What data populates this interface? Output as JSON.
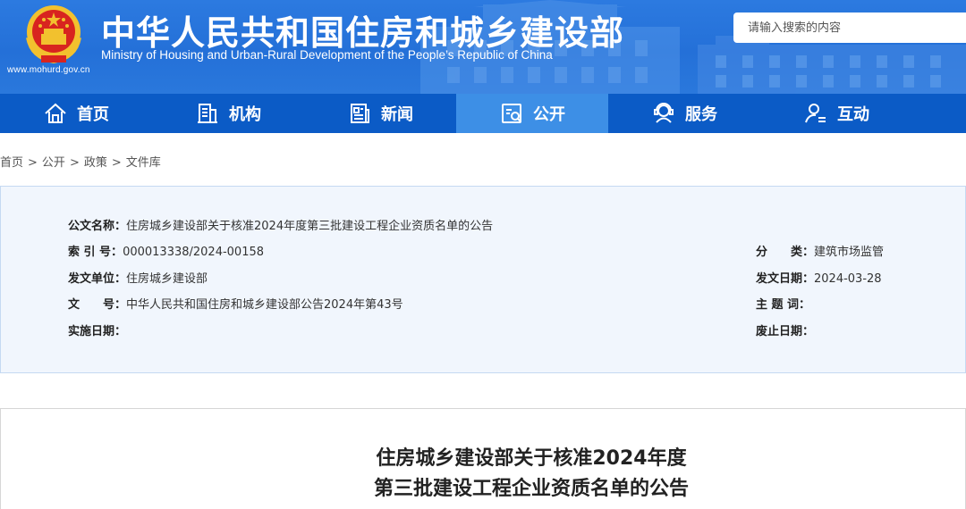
{
  "header": {
    "site_url": "www.mohurd.gov.cn",
    "title_cn": "中华人民共和国住房和城乡建设部",
    "title_en": "Ministry of Housing and Urban-Rural Development of the People’s Republic of China",
    "search_placeholder": "请输入搜索的内容",
    "emblem_icon": "national-emblem-icon"
  },
  "nav": [
    {
      "label": "首页",
      "icon": "home-icon"
    },
    {
      "label": "机构",
      "icon": "building-icon"
    },
    {
      "label": "新闻",
      "icon": "news-icon"
    },
    {
      "label": "公开",
      "icon": "disclosure-icon",
      "active": true
    },
    {
      "label": "服务",
      "icon": "service-icon"
    },
    {
      "label": "互动",
      "icon": "interaction-icon"
    },
    {
      "label": "",
      "icon": "more-icon"
    }
  ],
  "breadcrumb": {
    "items": [
      "首页",
      "公开",
      "政策",
      "文件库"
    ],
    "separator": ">"
  },
  "info": {
    "doc_name_label": "公文名称：",
    "doc_name_value": "住房城乡建设部关于核准2024年度第三批建设工程企业资质名单的公告",
    "index_label": "索 引 号：",
    "index_value": "000013338/2024-00158",
    "category_label": "分　　类：",
    "category_value": "建筑市场监管",
    "issuer_label": "发文单位：",
    "issuer_value": "住房城乡建设部",
    "issue_date_label": "发文日期：",
    "issue_date_value": "2024-03-28",
    "doc_no_label": "文　　号：",
    "doc_no_value": "中华人民共和国住房和城乡建设部公告2024年第43号",
    "keywords_label": "主 题 词：",
    "keywords_value": "",
    "effective_label": "实施日期：",
    "effective_value": "",
    "abolish_label": "废止日期：",
    "abolish_value": ""
  },
  "document": {
    "title_line1": "住房城乡建设部关于核准2024年度",
    "title_line2": "第三批建设工程企业资质名单的公告"
  },
  "colors": {
    "header_blue": "#2470d8",
    "nav_blue": "#0b5bc6",
    "nav_active": "#3d8fe6",
    "panel_bg": "#f1f6fd",
    "panel_border": "#c5d9f2"
  }
}
